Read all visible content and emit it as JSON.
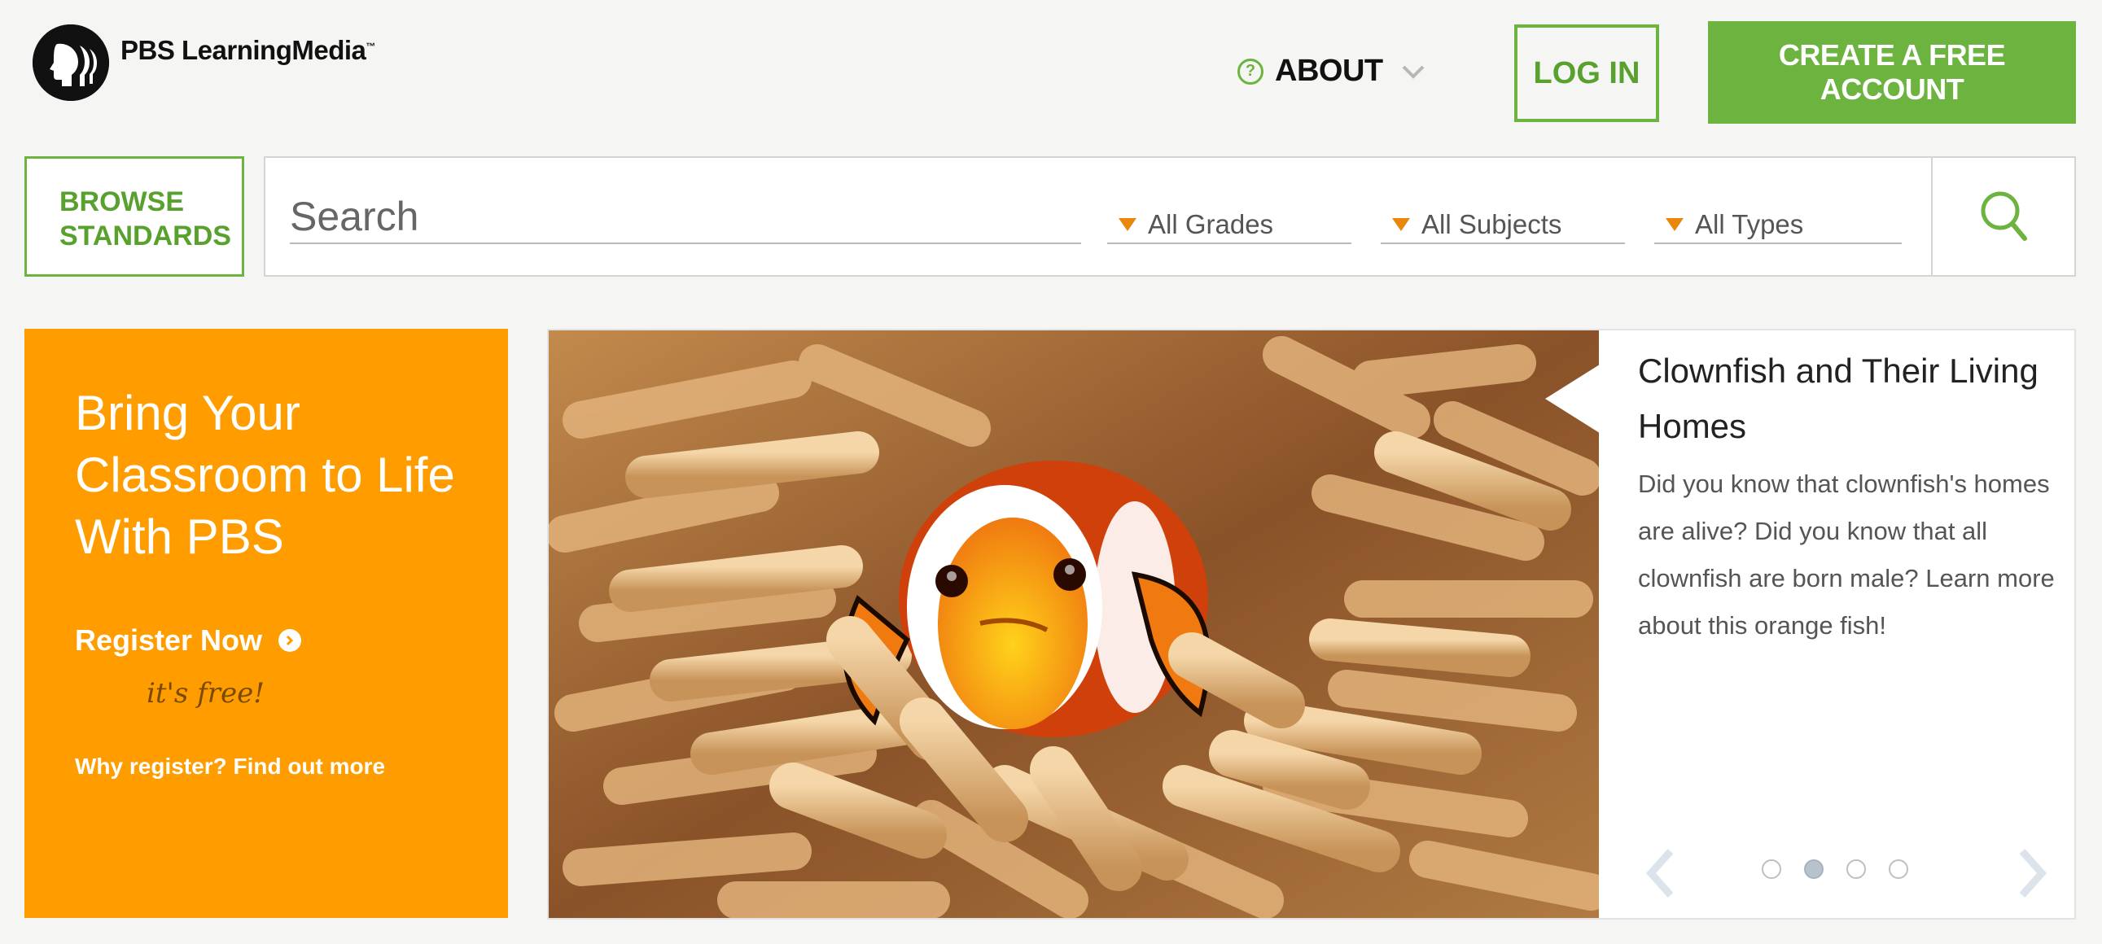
{
  "header": {
    "logo_text": "PBS LearningMedia",
    "logo_tm": "™",
    "about_label": "ABOUT",
    "login_label": "LOG IN",
    "create_account_label": "CREATE A FREE ACCOUNT"
  },
  "search": {
    "browse_line1": "BROWSE",
    "browse_line2": "STANDARDS",
    "placeholder": "Search",
    "filters": [
      {
        "label": "All Grades"
      },
      {
        "label": "All Subjects"
      },
      {
        "label": "All Types"
      }
    ]
  },
  "promo": {
    "headline": "Bring Your Classroom to Life With PBS",
    "register_label": "Register Now",
    "free_label": "it's free!",
    "why_label": "Why register? Find out more"
  },
  "carousel": {
    "title": "Clownfish and Their Living Homes",
    "description": "Did you know that clownfish's homes are alive? Did you know that all clownfish are born male? Learn more about this orange fish!",
    "dot_count": 4,
    "active_dot": 2
  },
  "colors": {
    "brand_green": "#6cb33f",
    "promo_orange": "#ff9c00",
    "filter_triangle": "#e8870c"
  }
}
